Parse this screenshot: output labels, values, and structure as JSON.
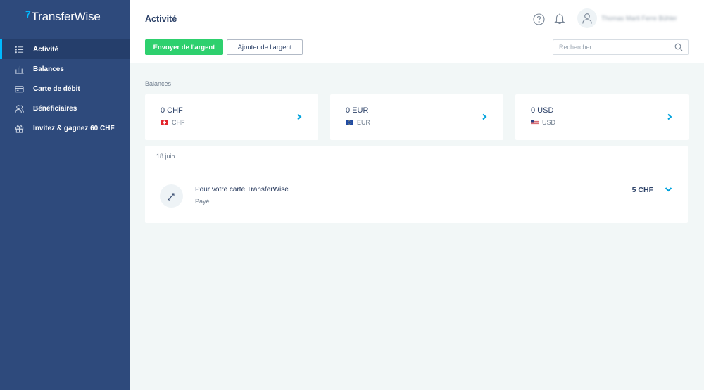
{
  "app": {
    "name": "TransferWise",
    "logo_mark": "7"
  },
  "sidebar": {
    "items": [
      {
        "label": "Activité",
        "icon": "list-icon",
        "active": true
      },
      {
        "label": "Balances",
        "icon": "bars-icon",
        "active": false
      },
      {
        "label": "Carte de débit",
        "icon": "card-icon",
        "active": false
      },
      {
        "label": "Bénéficiaires",
        "icon": "people-icon",
        "active": false
      },
      {
        "label": "Invitez & gagnez 60 CHF",
        "icon": "gift-icon",
        "active": false
      }
    ]
  },
  "header": {
    "title": "Activité",
    "send_label": "Envoyer de l'argent",
    "add_label": "Ajouter de l'argent",
    "search_placeholder": "Rechercher",
    "user_name": "Thomas Marti Ferre Bühler"
  },
  "balances": {
    "label": "Balances",
    "cards": [
      {
        "amount": "0 CHF",
        "currency": "CHF",
        "flag": "swiss-flag"
      },
      {
        "amount": "0 EUR",
        "currency": "EUR",
        "flag": "eu-flag"
      },
      {
        "amount": "0 USD",
        "currency": "USD",
        "flag": "us-flag"
      }
    ]
  },
  "activity": {
    "date": "18 juin",
    "transactions": [
      {
        "title_prefix": "Pour ",
        "title_name": "votre carte TransferWise",
        "status": "Payé",
        "amount": "5 CHF"
      }
    ]
  },
  "colors": {
    "sidebar_bg": "#2e4a7c",
    "accent": "#00b9ff",
    "send_button": "#2ed06e",
    "page_bg": "#f2f7f7"
  }
}
